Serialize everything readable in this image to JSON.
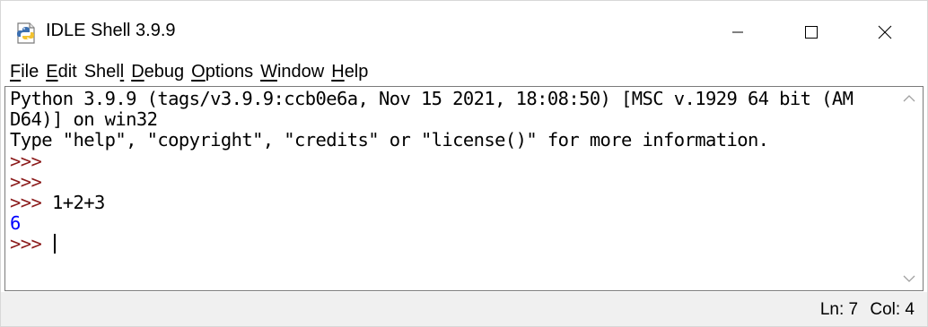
{
  "window": {
    "title": "IDLE Shell 3.9.9"
  },
  "menu": [
    {
      "label": "File",
      "underline_index": 0
    },
    {
      "label": "Edit",
      "underline_index": 0
    },
    {
      "label": "Shell",
      "underline_index": 4
    },
    {
      "label": "Debug",
      "underline_index": 0
    },
    {
      "label": "Options",
      "underline_index": 0
    },
    {
      "label": "Window",
      "underline_index": 0
    },
    {
      "label": "Help",
      "underline_index": 0
    }
  ],
  "shell": {
    "lines": [
      {
        "type": "text",
        "text": "Python 3.9.9 (tags/v3.9.9:ccb0e6a, Nov 15 2021, 18:08:50) [MSC v.1929 64 bit (AM"
      },
      {
        "type": "text",
        "text": "D64)] on win32"
      },
      {
        "type": "text",
        "text": "Type \"help\", \"copyright\", \"credits\" or \"license()\" for more information."
      },
      {
        "type": "prompt",
        "prompt": ">>>",
        "text": ""
      },
      {
        "type": "prompt",
        "prompt": ">>>",
        "text": ""
      },
      {
        "type": "prompt",
        "prompt": ">>>",
        "text": " 1+2+3"
      },
      {
        "type": "output",
        "text": "6"
      },
      {
        "type": "prompt",
        "prompt": ">>>",
        "text": " ",
        "caret": true
      }
    ]
  },
  "status": {
    "line": "Ln: 7",
    "col": "Col: 4"
  },
  "colors": {
    "prompt": "#8b1a1a",
    "output": "#0000ff"
  },
  "icons": {
    "app": "python-idle-icon",
    "minimize": "minimize-icon",
    "maximize": "maximize-icon",
    "close": "close-icon",
    "scroll_up": "chevron-up-icon",
    "scroll_down": "chevron-down-icon"
  }
}
